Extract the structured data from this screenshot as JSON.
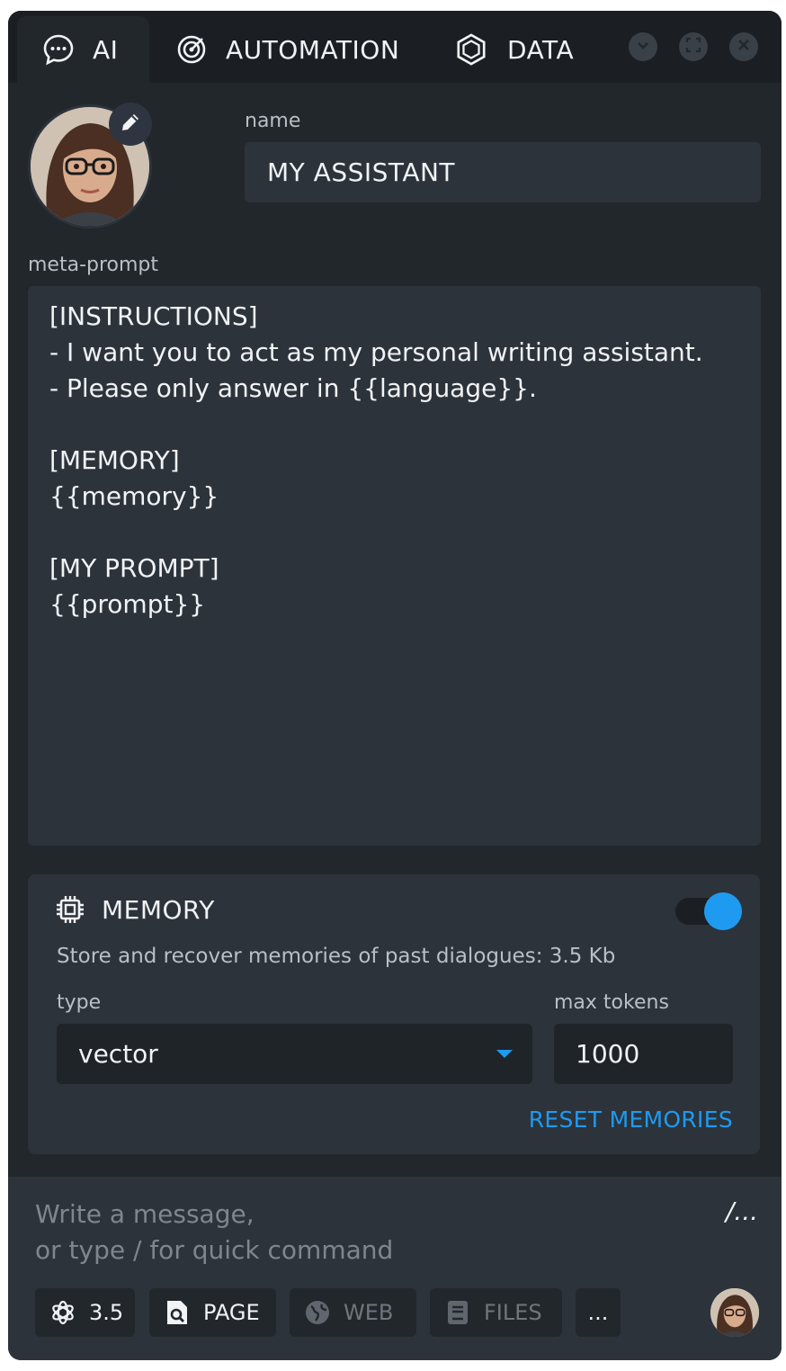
{
  "tabs": [
    {
      "label": "AI",
      "icon": "chat-bubble-icon",
      "active": true
    },
    {
      "label": "AUTOMATION",
      "icon": "radar-icon",
      "active": false
    },
    {
      "label": "DATA",
      "icon": "hexagon-icon",
      "active": false
    }
  ],
  "window_controls": [
    "chevron-down-icon",
    "fullscreen-icon",
    "close-icon"
  ],
  "name_field": {
    "label": "name",
    "value": "MY ASSISTANT"
  },
  "meta_prompt": {
    "label": "meta-prompt",
    "value": "[INSTRUCTIONS]\n- I want you to act as my personal writing assistant.\n- Please only answer in {{language}}.\n\n[MEMORY]\n{{memory}}\n\n[MY PROMPT]\n{{prompt}}"
  },
  "memory": {
    "title": "MEMORY",
    "enabled": true,
    "description": "Store and recover memories of past dialogues: 3.5 Kb",
    "type_label": "type",
    "type_value": "vector",
    "max_tokens_label": "max tokens",
    "max_tokens_value": "1000",
    "reset_label": "RESET MEMORIES"
  },
  "composer": {
    "placeholder_line1": "Write a message,",
    "placeholder_line2": "or type / for quick command",
    "slash_label": "/...",
    "chips": {
      "model": "3.5",
      "page": "PAGE",
      "web": "WEB",
      "files": "FILES",
      "more": "..."
    }
  },
  "colors": {
    "accent": "#1e9bf0",
    "panel": "#22272c",
    "field": "#2c333b"
  }
}
